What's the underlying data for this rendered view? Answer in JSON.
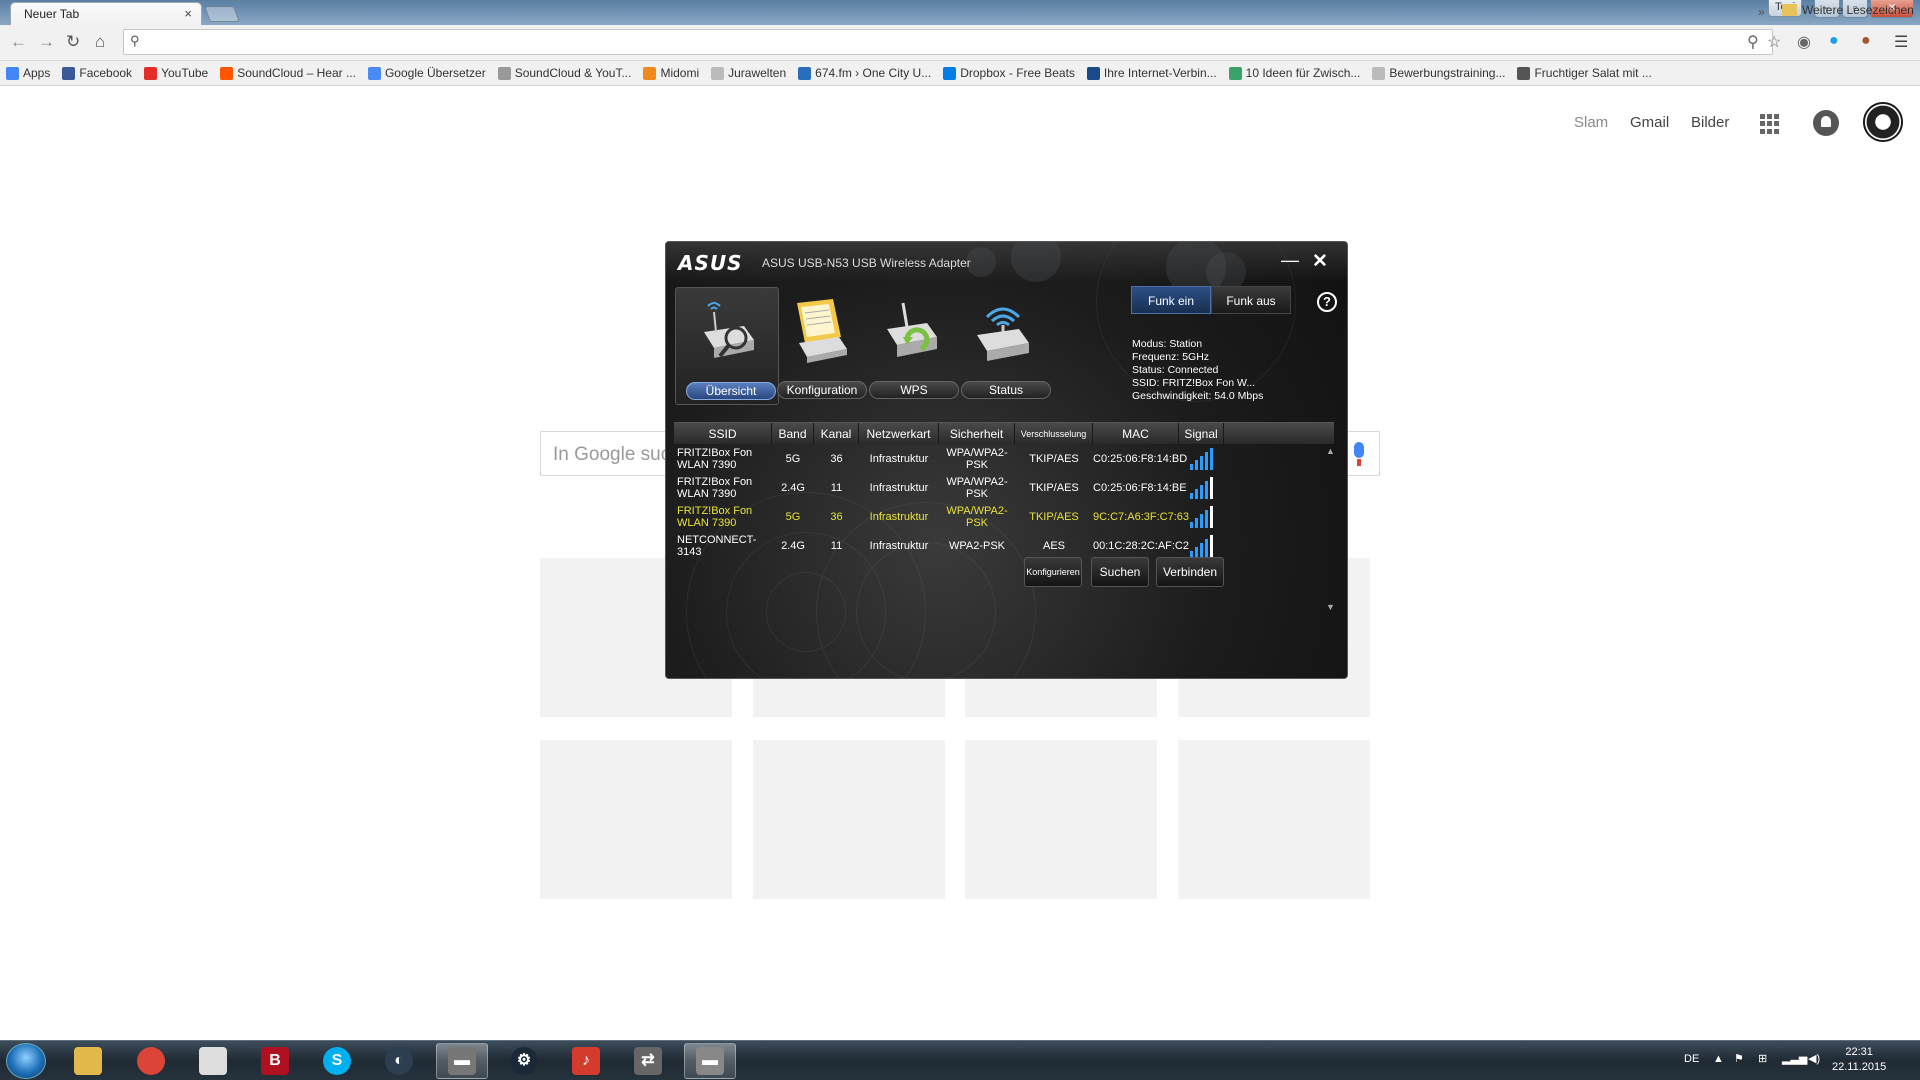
{
  "browser": {
    "tab_title": "Neuer Tab",
    "tab_close": "×",
    "user_badge": "Toni",
    "win_minimize": "–",
    "win_restore": "▫",
    "win_close": "✕"
  },
  "bookmarks": [
    {
      "label": "Apps",
      "icon": "apps-grid-icon",
      "color": "#4285f4"
    },
    {
      "label": "Facebook",
      "icon": "facebook-icon",
      "color": "#3b5998"
    },
    {
      "label": "YouTube",
      "icon": "youtube-icon",
      "color": "#e52d27"
    },
    {
      "label": "SoundCloud – Hear ...",
      "icon": "soundcloud-icon",
      "color": "#ff5500"
    },
    {
      "label": "Google Übersetzer",
      "icon": "translate-icon",
      "color": "#4a8af4"
    },
    {
      "label": "SoundCloud & YouT...",
      "icon": "page-icon",
      "color": "#999999"
    },
    {
      "label": "Midomi",
      "icon": "midomi-icon",
      "color": "#f08a1c"
    },
    {
      "label": "Jurawelten",
      "icon": "page-icon",
      "color": "#bbbbbb"
    },
    {
      "label": "674.fm › One City U...",
      "icon": "fm-icon",
      "color": "#2a6ebb"
    },
    {
      "label": "Dropbox - Free Beats",
      "icon": "dropbox-icon",
      "color": "#007ee5"
    },
    {
      "label": "Ihre Internet-Verbin...",
      "icon": "monitor-icon",
      "color": "#1a4a8a"
    },
    {
      "label": "10 Ideen für Zwisch...",
      "icon": "leaf-icon",
      "color": "#3aa36a"
    },
    {
      "label": "Bewerbungstraining...",
      "icon": "page-icon",
      "color": "#bbbbbb"
    },
    {
      "label": "Fruchtiger Salat mit ...",
      "icon": "circle-icon",
      "color": "#555555"
    }
  ],
  "bookmarks_overflow": "»",
  "bookmarks_other": "Weitere Lesezeichen",
  "google": {
    "links": {
      "slam": "Slam",
      "gmail": "Gmail",
      "images": "Bilder"
    },
    "search_placeholder": "In Google suchen"
  },
  "asus": {
    "logo": "ASUS",
    "title": "ASUS USB-N53 USB Wireless Adapter",
    "minimize": "—",
    "close": "✕",
    "help": "?",
    "nav": [
      {
        "label": "Übersicht",
        "active": true
      },
      {
        "label": "Konfiguration",
        "active": false
      },
      {
        "label": "WPS",
        "active": false
      },
      {
        "label": "Status",
        "active": false
      }
    ],
    "radio": {
      "on": "Funk ein",
      "off": "Funk aus"
    },
    "info": {
      "mode": "Modus: Station",
      "freq": "Frequenz: 5GHz",
      "status": "Status: Connected",
      "ssid": "SSID: FRITZ!Box Fon W...",
      "speed": "Geschwindigkeit: 54.0 Mbps"
    },
    "columns": [
      "SSID",
      "Band",
      "Kanal",
      "Netzwerkart",
      "Sicherheit",
      "Verschlusselung",
      "MAC",
      "Signal"
    ],
    "rows": [
      {
        "ssid": "FRITZ!Box Fon WLAN 7390",
        "band": "5G",
        "channel": "36",
        "type": "Infrastruktur",
        "security": "WPA/WPA2-PSK",
        "encryption": "TKIP/AES",
        "mac": "C0:25:06:F8:14:BD",
        "signal": 1.0,
        "selected": false
      },
      {
        "ssid": "FRITZ!Box Fon WLAN 7390",
        "band": "2.4G",
        "channel": "11",
        "type": "Infrastruktur",
        "security": "WPA/WPA2-PSK",
        "encryption": "TKIP/AES",
        "mac": "C0:25:06:F8:14:BE",
        "signal": 0.8,
        "selected": false
      },
      {
        "ssid": "FRITZ!Box Fon WLAN 7390",
        "band": "5G",
        "channel": "36",
        "type": "Infrastruktur",
        "security": "WPA/WPA2-PSK",
        "encryption": "TKIP/AES",
        "mac": "9C:C7:A6:3F:C7:63",
        "signal": 0.8,
        "selected": true
      },
      {
        "ssid": "NETCONNECT-3143",
        "band": "2.4G",
        "channel": "11",
        "type": "Infrastruktur",
        "security": "WPA2-PSK",
        "encryption": "AES",
        "mac": "00:1C:28:2C:AF:C2",
        "signal": 0.8,
        "selected": false
      }
    ],
    "buttons": {
      "configure": "Konfigurieren",
      "search": "Suchen",
      "connect": "Verbinden"
    }
  },
  "taskbar": {
    "apps": [
      {
        "name": "explorer",
        "icon": "folder-icon",
        "color": "#e3b84a",
        "glyph": ""
      },
      {
        "name": "chrome",
        "icon": "chrome-icon",
        "color": "#db4437",
        "glyph": ""
      },
      {
        "name": "documents",
        "icon": "document-icon",
        "color": "#dddddd",
        "glyph": ""
      },
      {
        "name": "bitdefender",
        "icon": "b-icon",
        "color": "#b01020",
        "glyph": "B"
      },
      {
        "name": "skype",
        "icon": "skype-icon",
        "color": "#00aff0",
        "glyph": "S"
      },
      {
        "name": "teamspeak",
        "icon": "teamspeak-icon",
        "color": "#2c3e50",
        "glyph": "◐"
      },
      {
        "name": "wireless-utility",
        "icon": "router-icon",
        "color": "#777777",
        "glyph": "▬"
      },
      {
        "name": "steam",
        "icon": "steam-icon",
        "color": "#1b2838",
        "glyph": "⚙"
      },
      {
        "name": "mp3",
        "icon": "mp3-icon",
        "color": "#d43b2c",
        "glyph": "♪"
      },
      {
        "name": "network-tool",
        "icon": "network-icon",
        "color": "#666666",
        "glyph": "⇄"
      },
      {
        "name": "asus-utility",
        "icon": "router-icon",
        "color": "#888888",
        "glyph": "▬"
      }
    ],
    "lang": "DE",
    "time": "22:31",
    "date": "22.11.2015"
  }
}
